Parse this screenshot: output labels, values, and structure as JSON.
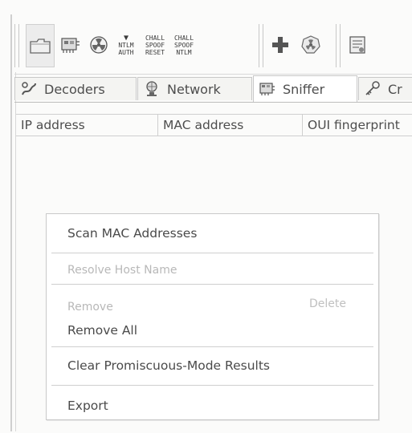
{
  "toolbar": {
    "buttons": [
      {
        "icon": "folder-icon"
      },
      {
        "icon": "sniffer-card-icon"
      },
      {
        "icon": "radiation-icon"
      },
      {
        "icon": "ntlm-auth-icon",
        "label_line1": "NTLM",
        "label_line2": "AUTH"
      },
      {
        "icon": "chall-spoof-reset-icon",
        "label_line1": "CHALL",
        "label_line2": "SPOOF",
        "label_line3": "RESET"
      },
      {
        "icon": "chall-spoof-ntlm-icon",
        "label_line1": "CHALL",
        "label_line2": "SPOOF",
        "label_line3": "NTLM"
      },
      {
        "icon": "plus-icon"
      },
      {
        "icon": "radiation-badge-icon"
      },
      {
        "icon": "certificate-icon"
      }
    ]
  },
  "tabs": [
    {
      "label": "Decoders",
      "icon": "decoders-icon"
    },
    {
      "label": "Network",
      "icon": "network-icon"
    },
    {
      "label": "Sniffer",
      "icon": "sniffer-icon"
    },
    {
      "label": "Cr",
      "icon": "cracker-icon"
    }
  ],
  "columns": [
    "IP address",
    "MAC address",
    "OUI fingerprint"
  ],
  "context_menu": {
    "scan_mac": "Scan MAC Addresses",
    "resolve_host": "Resolve Host Name",
    "remove": "Remove",
    "remove_shortcut": "Delete",
    "remove_all": "Remove All",
    "clear_promiscuous": "Clear Promiscuous-Mode Results",
    "export": "Export"
  }
}
